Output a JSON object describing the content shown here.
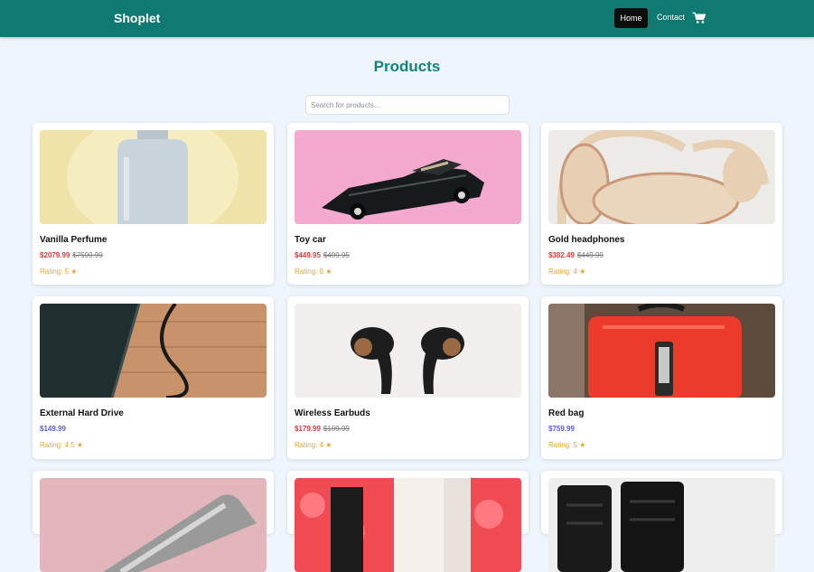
{
  "navbar": {
    "brand": "Shoplet",
    "home_label": "Home",
    "contact_label": "Contact",
    "cart_icon": "shopping-cart-icon"
  },
  "page_title": "Products",
  "search": {
    "placeholder": "Search for products...",
    "value": ""
  },
  "colors": {
    "navbar_bg": "#107a72",
    "title": "#128579",
    "sale_price": "#d83b3b",
    "regular_price": "#5a59e0",
    "rating": "#e5a52e",
    "page_bg": "#eef5fc"
  },
  "products": [
    {
      "name": "Vanilla Perfume",
      "price": "$2079.99",
      "old_price": "$7599.99",
      "rating": "Rating: 5 ★",
      "rating_value": 5
    },
    {
      "name": "Toy car",
      "price": "$449.95",
      "old_price": "$499.95",
      "rating": "Rating: 0 ★",
      "rating_value": 0
    },
    {
      "name": "Gold headphones",
      "price": "$382.49",
      "old_price": "$449.99",
      "rating": "Rating: 4 ★",
      "rating_value": 4
    },
    {
      "name": "External Hard Drive",
      "price": "$149.99",
      "old_price": "",
      "rating": "Rating: 4.5 ★",
      "rating_value": 4.5
    },
    {
      "name": "Wireless Earbuds",
      "price": "$179.99",
      "old_price": "$199.99",
      "rating": "Rating: 4 ★",
      "rating_value": 4
    },
    {
      "name": "Red bag",
      "price": "$759.99",
      "old_price": "",
      "rating": "Rating: 5 ★",
      "rating_value": 5
    },
    {
      "name": "",
      "price": "",
      "old_price": "",
      "rating": ""
    },
    {
      "name": "",
      "price": "",
      "old_price": "",
      "rating": ""
    },
    {
      "name": "",
      "price": "",
      "old_price": "",
      "rating": ""
    }
  ]
}
